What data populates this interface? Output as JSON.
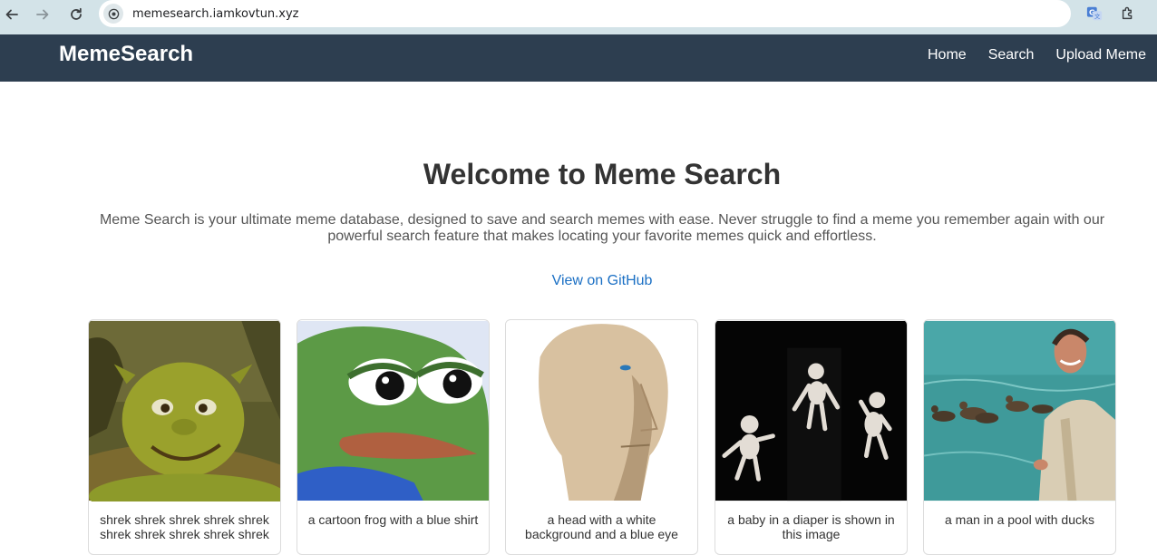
{
  "browser": {
    "url": "memesearch.iamkovtun.xyz",
    "icons": [
      "back-arrow-icon",
      "forward-arrow-icon",
      "reload-icon",
      "site-info-icon",
      "translate-icon",
      "extensions-icon"
    ]
  },
  "navbar": {
    "brand": "MemeSearch",
    "links": [
      {
        "label": "Home"
      },
      {
        "label": "Search"
      },
      {
        "label": "Upload Meme"
      }
    ],
    "background": "#2d3e50"
  },
  "hero": {
    "title": "Welcome to Meme Search",
    "description": "Meme Search is your ultimate meme database, designed to save and search memes with ease. Never struggle to find a meme you remember again with our powerful search feature that makes locating your favorite memes quick and effortless.",
    "github_link": "View on GitHub"
  },
  "memes": [
    {
      "caption": "shrek shrek shrek shrek shrek shrek shrek shrek shrek shrek"
    },
    {
      "caption": "a cartoon frog with a blue shirt"
    },
    {
      "caption": "a head with a white background and a blue eye"
    },
    {
      "caption": "a baby in a diaper is shown in this image"
    },
    {
      "caption": "a man in a pool with ducks"
    }
  ],
  "colors": {
    "link": "#1a6fc4",
    "title": "#333333"
  }
}
